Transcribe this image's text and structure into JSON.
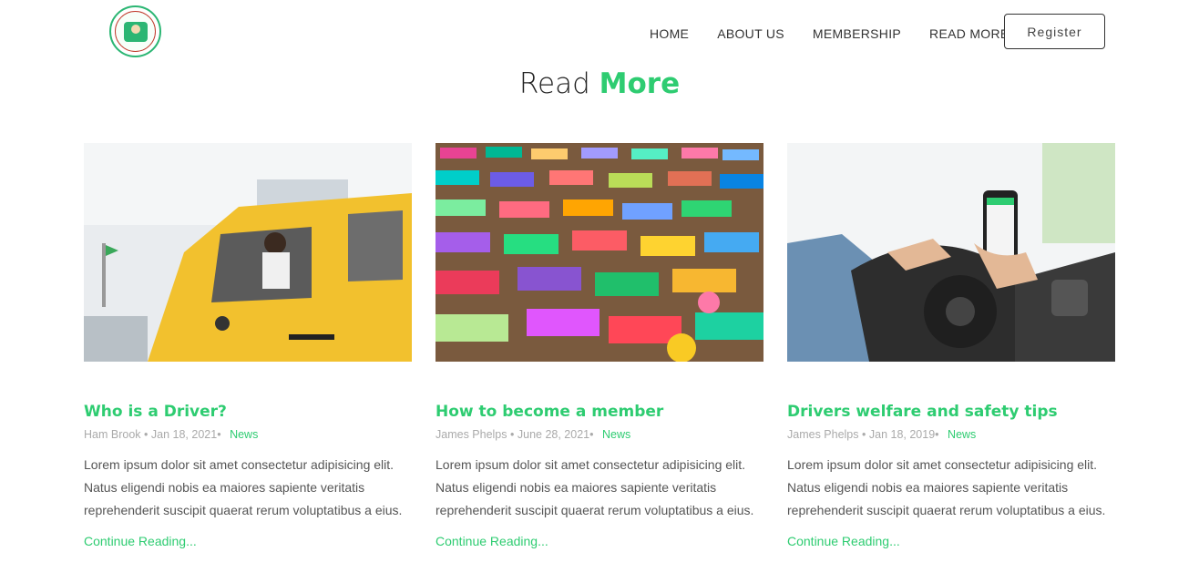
{
  "nav": {
    "items": [
      "HOME",
      "ABOUT US",
      "MEMBERSHIP",
      "READ MORE"
    ],
    "register_label": "Register"
  },
  "section": {
    "title_plain": "Read",
    "title_accent": "More"
  },
  "posts": [
    {
      "title": "Who is a Driver?",
      "author": "Ham Brook",
      "date": "Jan 18, 2021",
      "category": "News",
      "excerpt": "Lorem ipsum dolor sit amet consectetur adipisicing elit. Natus eligendi nobis ea maiores sapiente veritatis reprehenderit suscipit quaerat rerum voluptatibus a eius.",
      "link_label": "Continue Reading..."
    },
    {
      "title": "How to become a member",
      "author": "James Phelps",
      "date": "June 28, 2021",
      "category": "News",
      "excerpt": "Lorem ipsum dolor sit amet consectetur adipisicing elit. Natus eligendi nobis ea maiores sapiente veritatis reprehenderit suscipit quaerat rerum voluptatibus a eius.",
      "link_label": "Continue Reading..."
    },
    {
      "title": "Drivers welfare and safety tips",
      "author": "James Phelps",
      "date": "Jan 18, 2019",
      "category": "News",
      "excerpt": "Lorem ipsum dolor sit amet consectetur adipisicing elit. Natus eligendi nobis ea maiores sapiente veritatis reprehenderit suscipit quaerat rerum voluptatibus a eius.",
      "link_label": "Continue Reading..."
    }
  ],
  "colors": {
    "accent": "#2ecc71"
  }
}
